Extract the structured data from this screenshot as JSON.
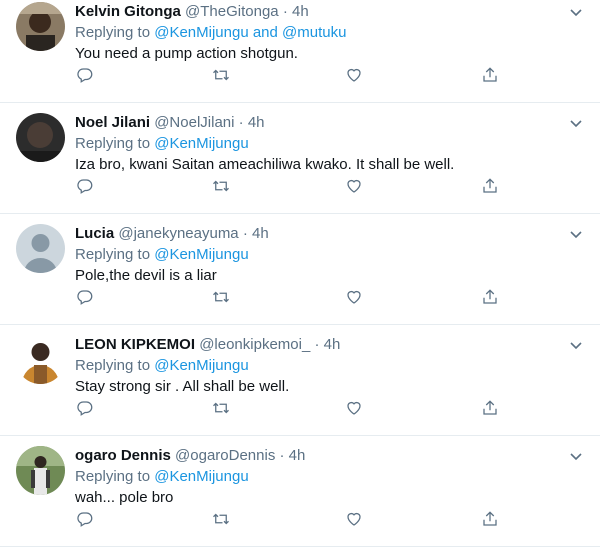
{
  "colors": {
    "link": "#1b95e0",
    "secondary": "#5b7083",
    "text": "#0f1419",
    "divider": "#e6ecf0"
  },
  "icons": {
    "reply": "reply-icon",
    "retweet": "retweet-icon",
    "like": "heart-icon",
    "share": "share-icon",
    "more": "chevron-down-icon"
  },
  "tweets": [
    {
      "name": "Kelvin Gitonga",
      "handle": "@TheGitonga",
      "dot": "·",
      "time": "4h",
      "replying_prefix": "Replying to ",
      "replying_to": "@KenMijungu and @mutuku",
      "text": "You need a pump action shotgun."
    },
    {
      "name": "Noel Jilani",
      "handle": "@NoelJilani",
      "dot": "·",
      "time": "4h",
      "replying_prefix": "Replying to ",
      "replying_to": "@KenMijungu",
      "text": "Iza bro, kwani Saitan ameachiliwa kwako. It shall be well."
    },
    {
      "name": "Lucia",
      "handle": "@janekyneayuma",
      "dot": "·",
      "time": "4h",
      "replying_prefix": "Replying to ",
      "replying_to": "@KenMijungu",
      "text": "Pole,the devil is a liar"
    },
    {
      "name": "LEON KIPKEMOI",
      "handle": "@leonkipkemoi_",
      "dot": "·",
      "time": "4h",
      "replying_prefix": "Replying to ",
      "replying_to": "@KenMijungu",
      "text": "Stay strong sir . All shall be well."
    },
    {
      "name": "ogaro Dennis",
      "handle": "@ogaroDennis",
      "dot": "·",
      "time": "4h",
      "replying_prefix": "Replying to ",
      "replying_to": "@KenMijungu",
      "text": "wah... pole bro"
    }
  ]
}
